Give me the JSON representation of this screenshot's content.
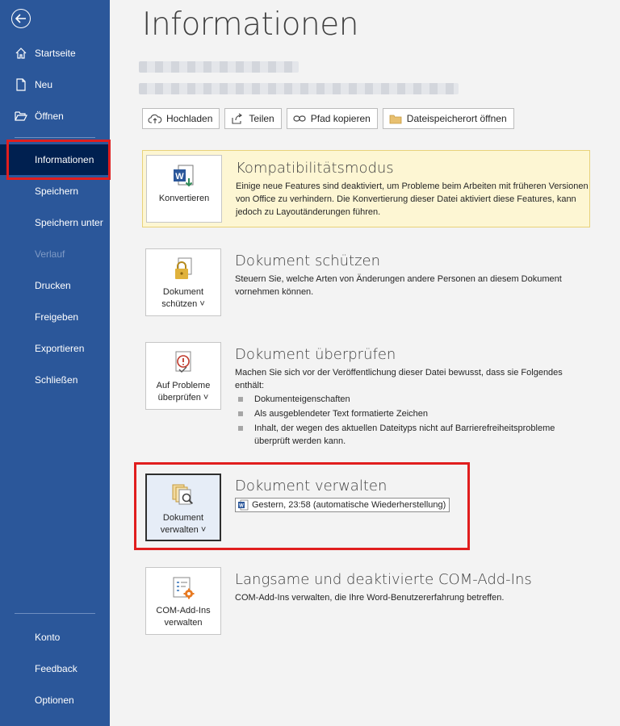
{
  "sidebar": {
    "items": [
      {
        "label": "Startseite",
        "icon": "home-icon"
      },
      {
        "label": "Neu",
        "icon": "new-document-icon"
      },
      {
        "label": "Öffnen",
        "icon": "open-folder-icon"
      },
      {
        "label": "Informationen",
        "active": true
      },
      {
        "label": "Speichern"
      },
      {
        "label": "Speichern unter"
      },
      {
        "label": "Verlauf",
        "disabled": true
      },
      {
        "label": "Drucken"
      },
      {
        "label": "Freigeben"
      },
      {
        "label": "Exportieren"
      },
      {
        "label": "Schließen"
      }
    ],
    "bottom": [
      {
        "label": "Konto"
      },
      {
        "label": "Feedback"
      },
      {
        "label": "Optionen"
      }
    ]
  },
  "page": {
    "title": "Informationen"
  },
  "toolbar": {
    "upload": "Hochladen",
    "share": "Teilen",
    "copy_path": "Pfad kopieren",
    "open_location": "Dateispeicherort öffnen"
  },
  "compat": {
    "button": "Konvertieren",
    "title": "Kompatibilitätsmodus",
    "desc": "Einige neue Features sind deaktiviert, um Probleme beim Arbeiten mit früheren Versionen von Office zu verhindern. Die Konvertierung dieser Datei aktiviert diese Features, kann jedoch zu Layoutänderungen führen."
  },
  "protect": {
    "button_line1": "Dokument",
    "button_line2": "schützen ˅",
    "title": "Dokument schützen",
    "desc": "Steuern Sie, welche Arten von Änderungen andere Personen an diesem Dokument vornehmen können."
  },
  "inspect": {
    "button_line1": "Auf Probleme",
    "button_line2": "überprüfen ˅",
    "title": "Dokument überprüfen",
    "desc": "Machen Sie sich vor der Veröffentlichung dieser Datei bewusst, dass sie Folgendes enthält:",
    "bullets": [
      "Dokumenteigenschaften",
      "Als ausgeblendeter Text formatierte Zeichen",
      "Inhalt, der wegen des aktuellen Dateityps nicht auf Barrierefreiheitsprobleme überprüft werden kann."
    ]
  },
  "manage": {
    "button_line1": "Dokument",
    "button_line2": "verwalten ˅",
    "title": "Dokument verwalten",
    "version": "Gestern, 23:58 (automatische Wiederherstellung)"
  },
  "addins": {
    "button_line1": "COM-Add-Ins",
    "button_line2": "verwalten",
    "title": "Langsame und deaktivierte COM-Add-Ins",
    "desc": "COM-Add-Ins verwalten, die Ihre Word-Benutzererfahrung betreffen."
  },
  "colors": {
    "sidebar": "#2b579a",
    "sidebar_active": "#002050",
    "highlight_red": "#e01e1e",
    "compat_bg": "#fdf6d3"
  }
}
